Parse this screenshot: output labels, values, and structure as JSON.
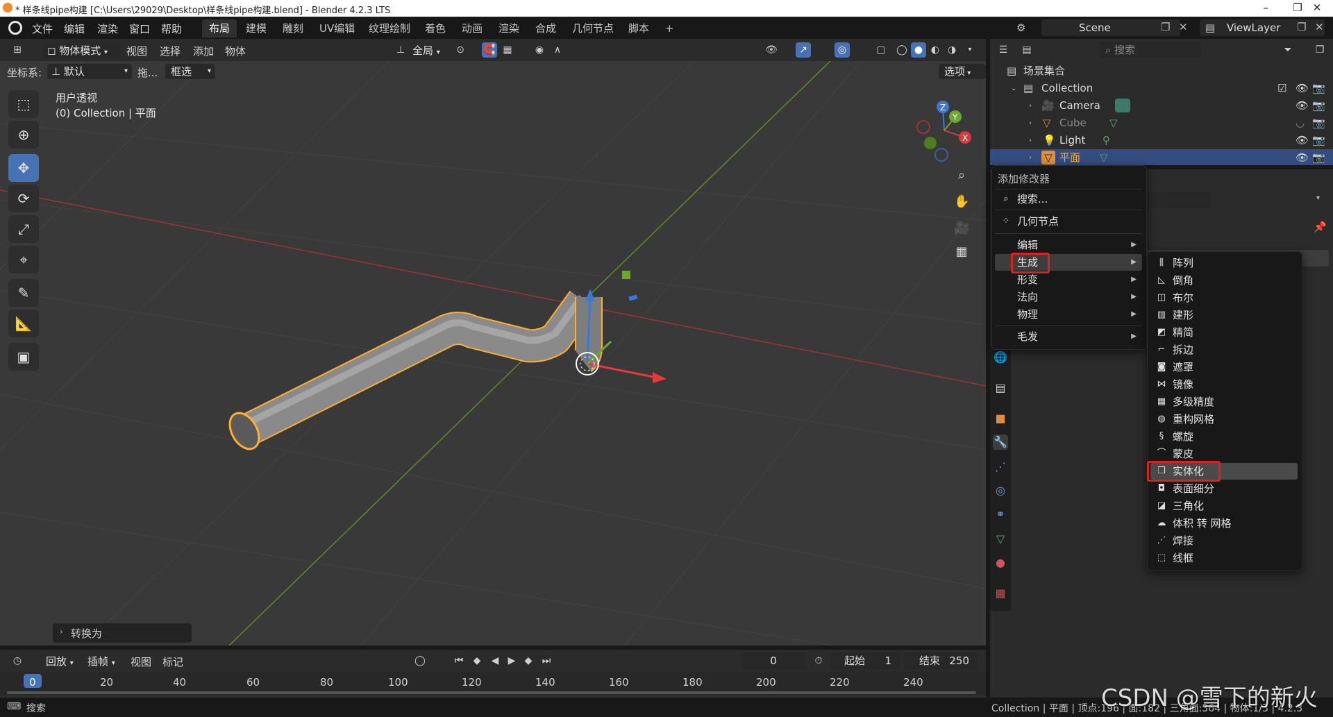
{
  "window": {
    "title": "* 样条线pipe构建 [C:\\Users\\29029\\Desktop\\样条线pipe构建.blend] - Blender 4.2.3 LTS",
    "controls": [
      "–",
      "❐",
      "✕"
    ]
  },
  "menubar": {
    "items": [
      "文件",
      "编辑",
      "渲染",
      "窗口",
      "帮助"
    ],
    "workspaces": [
      "布局",
      "建模",
      "雕刻",
      "UV编辑",
      "纹理绘制",
      "着色",
      "动画",
      "渲染",
      "合成",
      "几何节点",
      "脚本"
    ],
    "add_tab": "+",
    "scene": "Scene",
    "view_layer": "ViewLayer"
  },
  "viewport_header": {
    "mode": "物体模式",
    "menus": [
      "视图",
      "选择",
      "添加",
      "物体"
    ],
    "transform_orientation": "全局",
    "coord_label": "坐标系:",
    "coord_value": "默认",
    "drag_label": "拖...",
    "select_mode": "框选",
    "options": "选项"
  },
  "viewport": {
    "view_name": "用户透视",
    "collection_info": "(0) Collection | 平面",
    "last_op": "转换为",
    "gizmo": {
      "x": "X",
      "y": "Y",
      "z": "Z"
    }
  },
  "outliner": {
    "search_placeholder": "搜索",
    "root": "场景集合",
    "collection": "Collection",
    "objects": [
      {
        "name": "Camera",
        "color": "#e0e0e0"
      },
      {
        "name": "Cube",
        "color": "#8a8a8a"
      },
      {
        "name": "Light",
        "color": "#e0e0e0"
      },
      {
        "name": "平面",
        "color": "#ffaf29"
      }
    ]
  },
  "add_modifier_menu": {
    "title": "添加修改器",
    "search": "搜索...",
    "geometry_nodes": "几何节点",
    "categories": [
      "编辑",
      "生成",
      "形变",
      "法向",
      "物理"
    ],
    "hair": "毛发"
  },
  "generate_submenu": {
    "items": [
      "阵列",
      "倒角",
      "布尔",
      "建形",
      "精简",
      "拆边",
      "遮罩",
      "镜像",
      "多级精度",
      "重构网格",
      "螺旋",
      "蒙皮",
      "实体化",
      "表面细分",
      "三角化",
      "体积 转 网格",
      "焊接",
      "线框"
    ],
    "highlighted": "实体化"
  },
  "timeline": {
    "menus": [
      "回放",
      "插帧",
      "视图",
      "标记"
    ],
    "current_frame": "0",
    "start_label": "起始",
    "start": "1",
    "end_label": "结束",
    "end": "250",
    "ticks": [
      "0",
      "20",
      "40",
      "60",
      "80",
      "100",
      "120",
      "140",
      "160",
      "180",
      "200",
      "220",
      "240"
    ]
  },
  "statusbar": {
    "search": "搜索",
    "stats": "Collection | 平面 | 顶点:196 | 面:182 | 三角面:364 | 物体:1/3 | 4.2.3"
  },
  "watermark": "CSDN @雪下的新火",
  "colors": {
    "accent": "#4772b3",
    "selection_outline": "#ffaf29",
    "highlight_box": "#e02020",
    "x_axis": "#d23c3c",
    "y_axis": "#6fa72e",
    "z_axis": "#3a78d6"
  }
}
